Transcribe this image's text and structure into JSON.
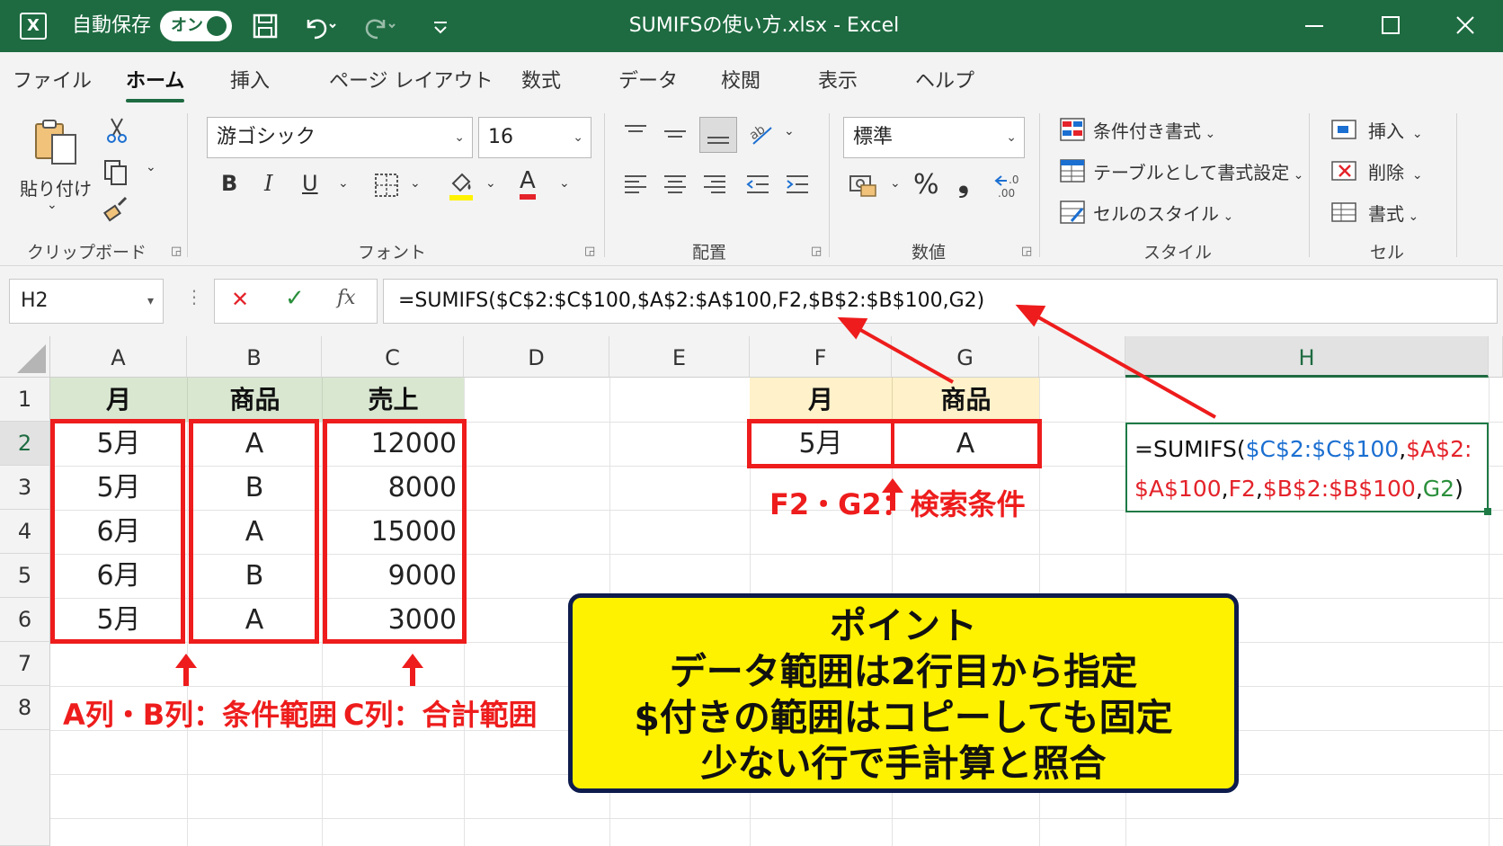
{
  "titlebar": {
    "app_icon": "X",
    "autosave_label": "自動保存",
    "autosave_state": "オン",
    "title": "SUMIFSの使い方.xlsx  -  Excel",
    "icons": [
      "save-icon",
      "undo-icon",
      "redo-icon",
      "customize-icon",
      "minimize-icon",
      "maximize-icon",
      "close-icon"
    ]
  },
  "menu": {
    "items": [
      "ファイル",
      "ホーム",
      "挿入",
      "ページ レイアウト",
      "数式",
      "データ",
      "校閲",
      "表示",
      "ヘルプ"
    ],
    "active_index": 1
  },
  "ribbon": {
    "clipboard": {
      "paste_label": "貼り付け",
      "group_label": "クリップボード"
    },
    "font": {
      "font_name": "游ゴシック",
      "font_size": "16",
      "bold": "B",
      "italic": "I",
      "underline": "U",
      "font_color_glyph": "A",
      "group_label": "フォント"
    },
    "alignment": {
      "group_label": "配置"
    },
    "number": {
      "format": "標準",
      "percent": "%",
      "comma": "❟",
      "group_label": "数値"
    },
    "styles": {
      "conditional": "条件付き書式",
      "as_table": "テーブルとして書式設定",
      "cell_styles": "セルのスタイル",
      "group_label": "スタイル"
    },
    "cells": {
      "insert": "挿入",
      "delete": "削除",
      "format": "書式",
      "group_label": "セル"
    }
  },
  "formula_bar": {
    "name_box": "H2",
    "cancel_glyph": "✕",
    "enter_glyph": "✓",
    "fx_glyph": "fx",
    "formula": "=SUMIFS($C$2:$C$100,$A$2:$A$100,F2,$B$2:$B$100,G2)"
  },
  "sheet": {
    "columns": [
      "A",
      "B",
      "C",
      "D",
      "E",
      "F",
      "G",
      "H"
    ],
    "rows": [
      "1",
      "2",
      "3",
      "4",
      "5",
      "6",
      "7",
      "8"
    ],
    "selected_column": "H",
    "selected_row": "2",
    "data_headers": [
      "月",
      "商品",
      "売上"
    ],
    "data_rows": [
      [
        "5月",
        "A",
        "12000"
      ],
      [
        "5月",
        "B",
        "8000"
      ],
      [
        "6月",
        "A",
        "15000"
      ],
      [
        "6月",
        "B",
        "9000"
      ],
      [
        "5月",
        "A",
        "3000"
      ]
    ],
    "criteria_headers": [
      "月",
      "商品"
    ],
    "criteria_values": [
      "5月",
      "A"
    ],
    "h2_formula": {
      "line1": [
        {
          "text": "=SUMIFS(",
          "color": "black"
        },
        {
          "text": "$C$2:$C$100",
          "color": "blue"
        },
        {
          "text": ",",
          "color": "black"
        },
        {
          "text": "$A$2:",
          "color": "red"
        }
      ],
      "line2": [
        {
          "text": "$A$100",
          "color": "red"
        },
        {
          "text": ",",
          "color": "black"
        },
        {
          "text": "F2",
          "color": "red"
        },
        {
          "text": ",",
          "color": "black"
        },
        {
          "text": "$B$2:$B$100",
          "color": "red"
        },
        {
          "text": ",",
          "color": "black"
        },
        {
          "text": "G2",
          "color": "green"
        },
        {
          "text": ")",
          "color": "black"
        }
      ]
    }
  },
  "annotations": {
    "criteria_range": "A列・B列：条件範囲",
    "sum_range": "C列：合計範囲",
    "search_criteria": "F2・G2：検索条件",
    "point_lines": [
      "ポイント",
      "データ範囲は2行目から指定",
      "$付きの範囲はコピーしても固定",
      "少ない行で手計算と照合"
    ]
  },
  "colors": {
    "excel_green": "#1e6b41",
    "annotation_red": "#ee1c1c",
    "header_green_fill": "#d9e7d1",
    "header_yellow_fill": "#fff1c9",
    "point_fill": "#fff200",
    "point_border": "#0e1b4d",
    "formula_blue": "#1b6fd1",
    "formula_red": "#e4232a",
    "formula_green": "#2a8f3b"
  }
}
